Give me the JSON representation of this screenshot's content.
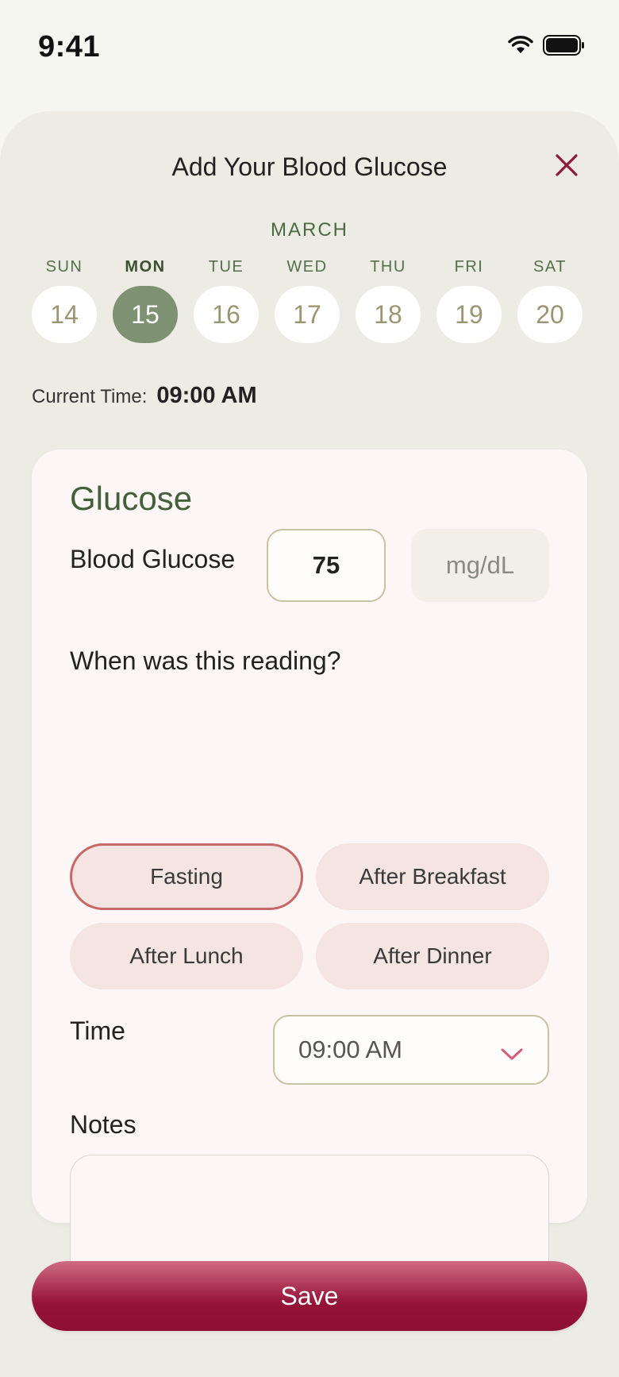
{
  "status_bar": {
    "time": "9:41"
  },
  "sheet": {
    "title": "Add Your Blood Glucose",
    "month": "MARCH",
    "days": [
      {
        "label": "SUN",
        "num": "14"
      },
      {
        "label": "MON",
        "num": "15"
      },
      {
        "label": "TUE",
        "num": "16"
      },
      {
        "label": "WED",
        "num": "17"
      },
      {
        "label": "THU",
        "num": "18"
      },
      {
        "label": "FRI",
        "num": "19"
      },
      {
        "label": "SAT",
        "num": "20"
      }
    ],
    "selected_day": "MON",
    "current_time_label": "Current Time:",
    "current_time_value": "09:00 AM"
  },
  "card": {
    "title": "Glucose",
    "blood_glucose_label": "Blood Glucose",
    "blood_glucose_value": "75",
    "unit": "mg/dL",
    "question": "When was this reading?",
    "options": [
      "Fasting",
      "After Breakfast",
      "After Lunch",
      "After Dinner"
    ],
    "selected_option": "Fasting",
    "time_label": "Time",
    "time_value": "09:00 AM",
    "notes_label": "Notes",
    "notes_value": ""
  },
  "save_label": "Save",
  "colors": {
    "accent_green": "#7e9172",
    "accent_red": "#951338",
    "selected_border": "#c86767"
  }
}
